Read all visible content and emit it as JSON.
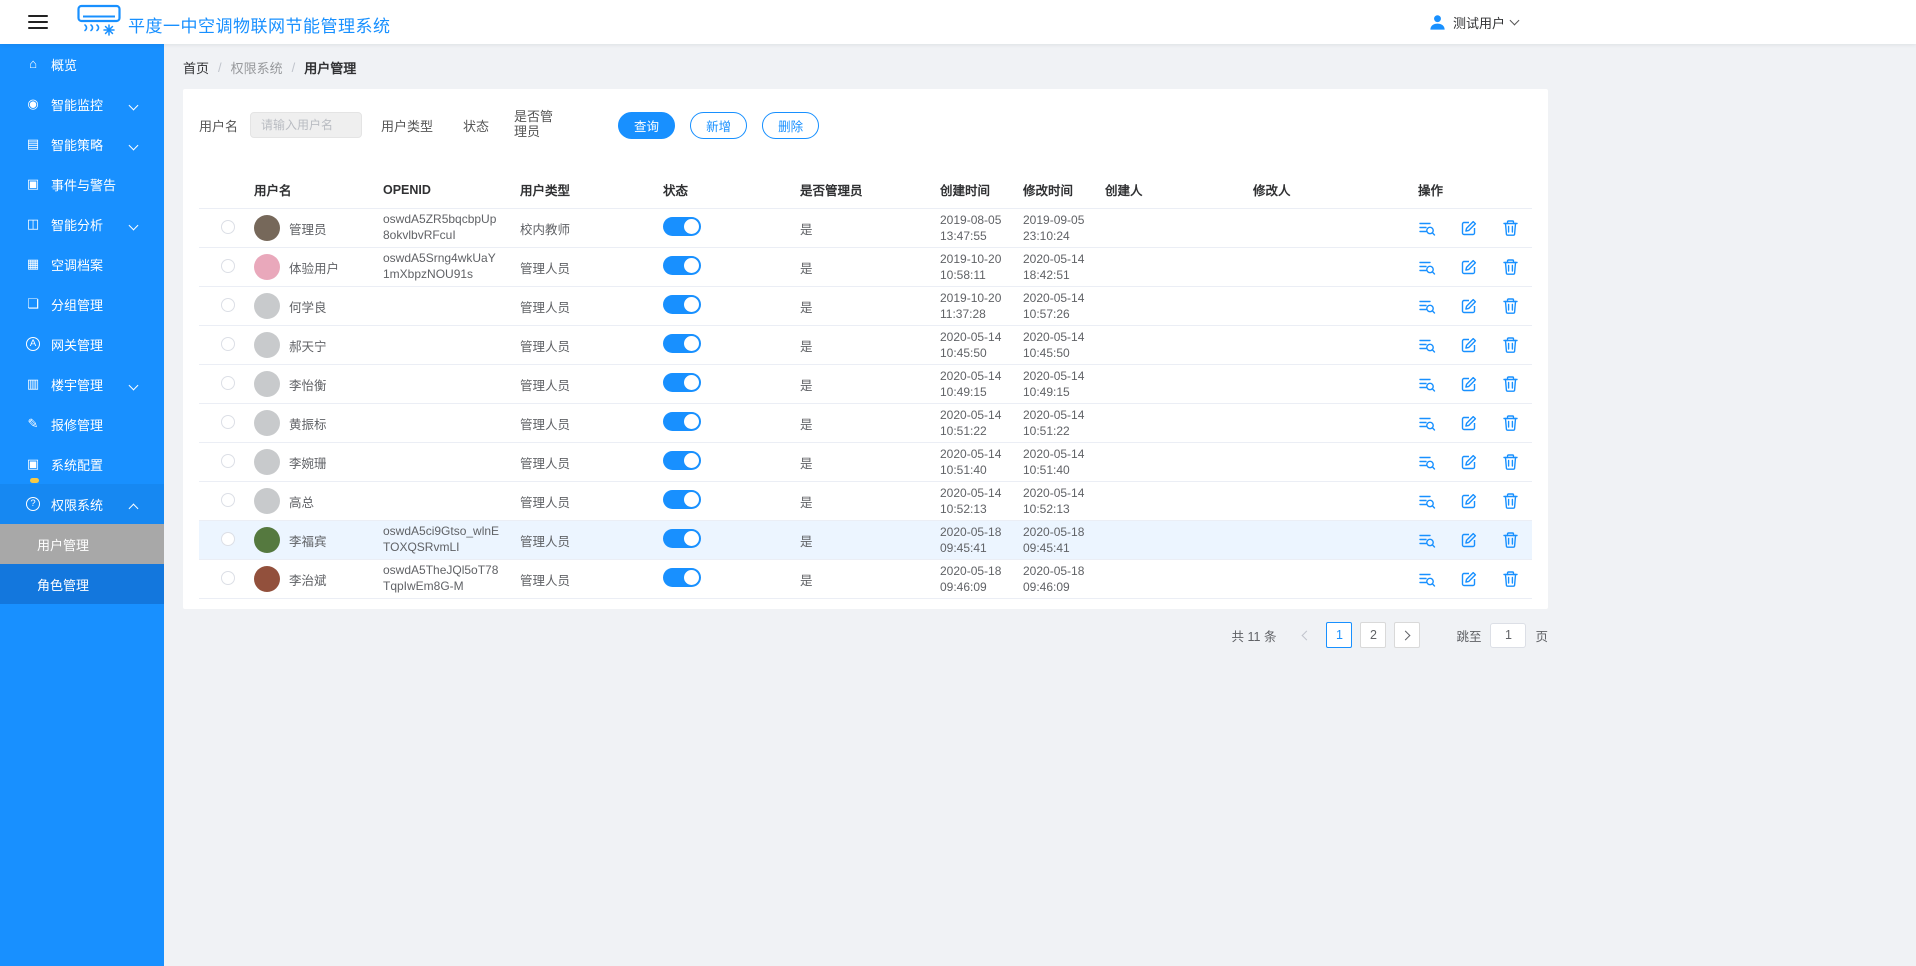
{
  "theme": {
    "primary_color": "#1890ff",
    "sidebar_color": "#1890ff",
    "highlight_row_color": "#ecf5ff",
    "badge_color": "#f8c945"
  },
  "header": {
    "title": "平度一中空调物联网节能管理系统",
    "user_name": "测试用户"
  },
  "sidebar": {
    "items": [
      {
        "label": "概览",
        "icon": "home-icon"
      },
      {
        "label": "智能监控",
        "icon": "eye-icon",
        "expandable": true
      },
      {
        "label": "智能策略",
        "icon": "strategy-icon",
        "expandable": true
      },
      {
        "label": "事件与警告",
        "icon": "alert-icon"
      },
      {
        "label": "智能分析",
        "icon": "analysis-icon",
        "expandable": true
      },
      {
        "label": "空调档案",
        "icon": "archive-icon"
      },
      {
        "label": "分组管理",
        "icon": "group-icon"
      },
      {
        "label": "网关管理",
        "icon": "gateway-icon"
      },
      {
        "label": "楼宇管理",
        "icon": "building-icon",
        "expandable": true
      },
      {
        "label": "报修管理",
        "icon": "repair-icon"
      },
      {
        "label": "系统配置",
        "icon": "config-icon",
        "badge": true
      },
      {
        "label": "权限系统",
        "icon": "permission-icon",
        "expandable": true,
        "expanded": true,
        "children": [
          {
            "label": "用户管理",
            "active": true
          },
          {
            "label": "角色管理",
            "active": false
          }
        ]
      }
    ]
  },
  "breadcrumb": {
    "items": [
      "首页",
      "权限系统",
      "用户管理"
    ]
  },
  "filters": {
    "username_label": "用户名",
    "username_placeholder": "请输入用户名",
    "user_type_label": "用户类型",
    "status_label": "状态",
    "admin_label": "是否管理员",
    "search_button": "查询",
    "add_button": "新增",
    "delete_button": "删除"
  },
  "table": {
    "columns": [
      "用户名",
      "OPENID",
      "用户类型",
      "状态",
      "是否管理员",
      "创建时间",
      "修改时间",
      "创建人",
      "修改人",
      "操作"
    ],
    "rows": [
      {
        "username": "管理员",
        "avatar_color": "#76685a",
        "openid": "oswdA5ZR5bqcbpUp8okvlbvRFcuI",
        "user_type": "校内教师",
        "status_on": true,
        "is_admin": "是",
        "created": "2019-08-05 13:47:55",
        "modified": "2019-09-05 23:10:24",
        "creator": "",
        "modifier": "",
        "highlighted": false
      },
      {
        "username": "体验用户",
        "avatar_color": "#e9a8bb",
        "openid": "oswdA5Srng4wkUaY1mXbpzNOU91s",
        "user_type": "管理人员",
        "status_on": true,
        "is_admin": "是",
        "created": "2019-10-20 10:58:11",
        "modified": "2020-05-14 18:42:51",
        "creator": "",
        "modifier": "",
        "highlighted": false
      },
      {
        "username": "何学良",
        "avatar_color": "#c8cacc",
        "openid": "",
        "user_type": "管理人员",
        "status_on": true,
        "is_admin": "是",
        "created": "2019-10-20 11:37:28",
        "modified": "2020-05-14 10:57:26",
        "creator": "",
        "modifier": "",
        "highlighted": false
      },
      {
        "username": "郝天宁",
        "avatar_color": "#c8cacc",
        "openid": "",
        "user_type": "管理人员",
        "status_on": true,
        "is_admin": "是",
        "created": "2020-05-14 10:45:50",
        "modified": "2020-05-14 10:45:50",
        "creator": "",
        "modifier": "",
        "highlighted": false
      },
      {
        "username": "李怡衡",
        "avatar_color": "#c8cacc",
        "openid": "",
        "user_type": "管理人员",
        "status_on": true,
        "is_admin": "是",
        "created": "2020-05-14 10:49:15",
        "modified": "2020-05-14 10:49:15",
        "creator": "",
        "modifier": "",
        "highlighted": false
      },
      {
        "username": "黄振标",
        "avatar_color": "#c8cacc",
        "openid": "",
        "user_type": "管理人员",
        "status_on": true,
        "is_admin": "是",
        "created": "2020-05-14 10:51:22",
        "modified": "2020-05-14 10:51:22",
        "creator": "",
        "modifier": "",
        "highlighted": false
      },
      {
        "username": "李婉珊",
        "avatar_color": "#c8cacc",
        "openid": "",
        "user_type": "管理人员",
        "status_on": true,
        "is_admin": "是",
        "created": "2020-05-14 10:51:40",
        "modified": "2020-05-14 10:51:40",
        "creator": "",
        "modifier": "",
        "highlighted": false
      },
      {
        "username": "高总",
        "avatar_color": "#c8cacc",
        "openid": "",
        "user_type": "管理人员",
        "status_on": true,
        "is_admin": "是",
        "created": "2020-05-14 10:52:13",
        "modified": "2020-05-14 10:52:13",
        "creator": "",
        "modifier": "",
        "highlighted": false
      },
      {
        "username": "李福宾",
        "avatar_color": "#55793f",
        "openid": "oswdA5ci9Gtso_wlnETOXQSRvmLI",
        "user_type": "管理人员",
        "status_on": true,
        "is_admin": "是",
        "created": "2020-05-18 09:45:41",
        "modified": "2020-05-18 09:45:41",
        "creator": "",
        "modifier": "",
        "highlighted": true
      },
      {
        "username": "李治斌",
        "avatar_color": "#92503c",
        "openid": "oswdA5TheJQl5oT78TqpIwEm8G-M",
        "user_type": "管理人员",
        "status_on": true,
        "is_admin": "是",
        "created": "2020-05-18 09:46:09",
        "modified": "2020-05-18 09:46:09",
        "creator": "",
        "modifier": "",
        "highlighted": false
      }
    ]
  },
  "pagination": {
    "total_text": "共 11 条",
    "pages": [
      "1",
      "2"
    ],
    "active_page": "1",
    "jump_label": "跳至",
    "jump_value": "1",
    "jump_suffix": "页"
  }
}
